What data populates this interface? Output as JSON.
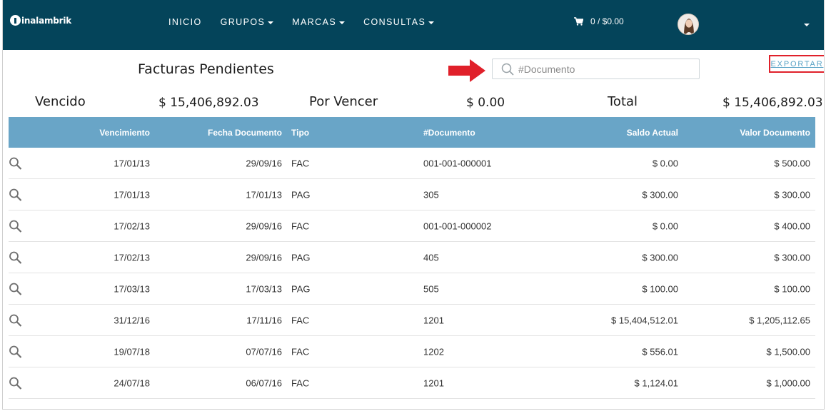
{
  "nav": {
    "logo": "inalambrik",
    "items": [
      {
        "label": "INICIO",
        "dropdown": false
      },
      {
        "label": "GRUPOS",
        "dropdown": true
      },
      {
        "label": "MARCAS",
        "dropdown": true
      },
      {
        "label": "CONSULTAS",
        "dropdown": true
      }
    ],
    "cart": "0 / $0.00"
  },
  "header": {
    "title": "Facturas Pendientes",
    "search_placeholder": "#Documento",
    "export_label": "EXPORTAR"
  },
  "summary": {
    "vencido_label": "Vencido",
    "vencido_value": "$ 15,406,892.03",
    "por_vencer_label": "Por Vencer",
    "por_vencer_value": "$ 0.00",
    "total_label": "Total",
    "total_value": "$ 15,406,892.03"
  },
  "table": {
    "columns": [
      "Vencimiento",
      "Fecha Documento",
      "Tipo",
      "#Documento",
      "Saldo Actual",
      "Valor Documento"
    ],
    "rows": [
      [
        "17/01/13",
        "29/09/16",
        "FAC",
        "001-001-000001",
        "$ 0.00",
        "$ 500.00"
      ],
      [
        "17/01/13",
        "17/01/13",
        "PAG",
        "305",
        "$ 300.00",
        "$ 300.00"
      ],
      [
        "17/02/13",
        "29/09/16",
        "FAC",
        "001-001-000002",
        "$ 0.00",
        "$ 400.00"
      ],
      [
        "17/02/13",
        "29/09/16",
        "PAG",
        "405",
        "$ 300.00",
        "$ 300.00"
      ],
      [
        "17/03/13",
        "17/03/13",
        "PAG",
        "505",
        "$ 100.00",
        "$ 100.00"
      ],
      [
        "31/12/16",
        "17/11/16",
        "FAC",
        "1201",
        "$ 15,404,512.01",
        "$ 1,205,112.65"
      ],
      [
        "19/07/18",
        "07/07/16",
        "FAC",
        "1202",
        "$ 556.01",
        "$ 1,500.00"
      ],
      [
        "24/07/18",
        "06/07/16",
        "FAC",
        "1201",
        "$ 1,124.01",
        "$ 1,000.00"
      ]
    ]
  },
  "colors": {
    "topbar": "#04445a",
    "table_header": "#69a5c7",
    "export_border": "#e0202a",
    "export_text": "#5aa3c6",
    "arrow": "#e0202a"
  }
}
